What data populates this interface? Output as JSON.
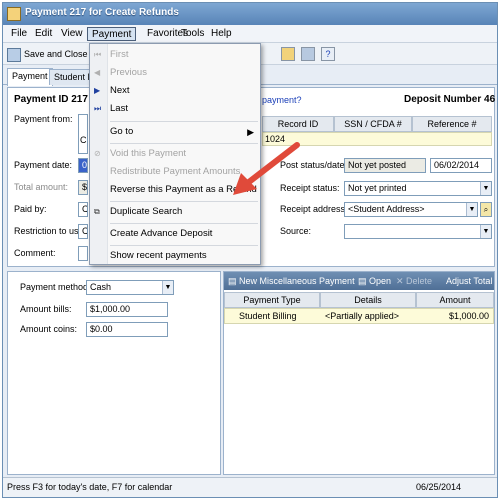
{
  "window": {
    "title": "Payment 217 for Create Refunds"
  },
  "menubar": {
    "items": [
      "File",
      "Edit",
      "View",
      "Payment",
      "Favorites",
      "Tools",
      "Help"
    ]
  },
  "toolbar": {
    "save_close_label": "Save and Close"
  },
  "tabs": [
    "Payment",
    "Student E"
  ],
  "header": {
    "payment_id": "Payment ID 217",
    "link_text": "payment?",
    "deposit_number": "Deposit Number 46"
  },
  "form": {
    "payment_from_label": "Payment from:",
    "payment_date_label": "Payment date:",
    "payment_date_value": "0",
    "total_amount_label": "Total amount:",
    "total_amount_value": "$",
    "paid_by_label": "Paid by:",
    "paid_by_value": "C",
    "restriction_label": "Restriction to use:",
    "restriction_value": "C",
    "comment_label": "Comment:",
    "record_grid": {
      "columns": [
        "Record ID",
        "SSN / CFDA #",
        "Reference #"
      ],
      "first_cell": "1024",
      "left_cell": "C"
    },
    "post_status_label": "Post status/date:",
    "post_status_value": "Not yet posted",
    "post_date_value": "06/02/2014",
    "receipt_status_label": "Receipt status:",
    "receipt_status_value": "Not yet printed",
    "receipt_address_label": "Receipt address:",
    "receipt_address_value": "<Student Address>",
    "source_label": "Source:",
    "source_value": ""
  },
  "method": {
    "payment_method_label": "Payment method:",
    "payment_method_value": "Cash",
    "amount_bills_label": "Amount bills:",
    "amount_bills_value": "$1,000.00",
    "amount_coins_label": "Amount coins:",
    "amount_coins_value": "$0.00"
  },
  "applications": {
    "toolbar": {
      "new_label": "New Miscellaneous Payment",
      "open_label": "Open",
      "delete_label": "Delete",
      "adjust_label": "Adjust Total"
    },
    "columns": [
      "Payment Type",
      "Details",
      "Amount"
    ],
    "rows": [
      {
        "type": "Student Billing",
        "details": "<Partially applied>",
        "amount": "$1,000.00"
      }
    ]
  },
  "payment_menu": {
    "first": "First",
    "previous": "Previous",
    "next": "Next",
    "last": "Last",
    "go_to": "Go to",
    "void": "Void this Payment",
    "redistribute": "Redistribute Payment Amounts",
    "reverse": "Reverse this Payment as a Refund",
    "duplicate_search": "Duplicate Search",
    "advance_deposit": "Create Advance Deposit",
    "show_recent": "Show recent payments"
  },
  "status": {
    "hint": "Press F3 for today's date, F7 for calendar",
    "date": "06/25/2014"
  },
  "colors": {
    "arrow": "#e04a3a",
    "title_bar": "#5884b7"
  }
}
